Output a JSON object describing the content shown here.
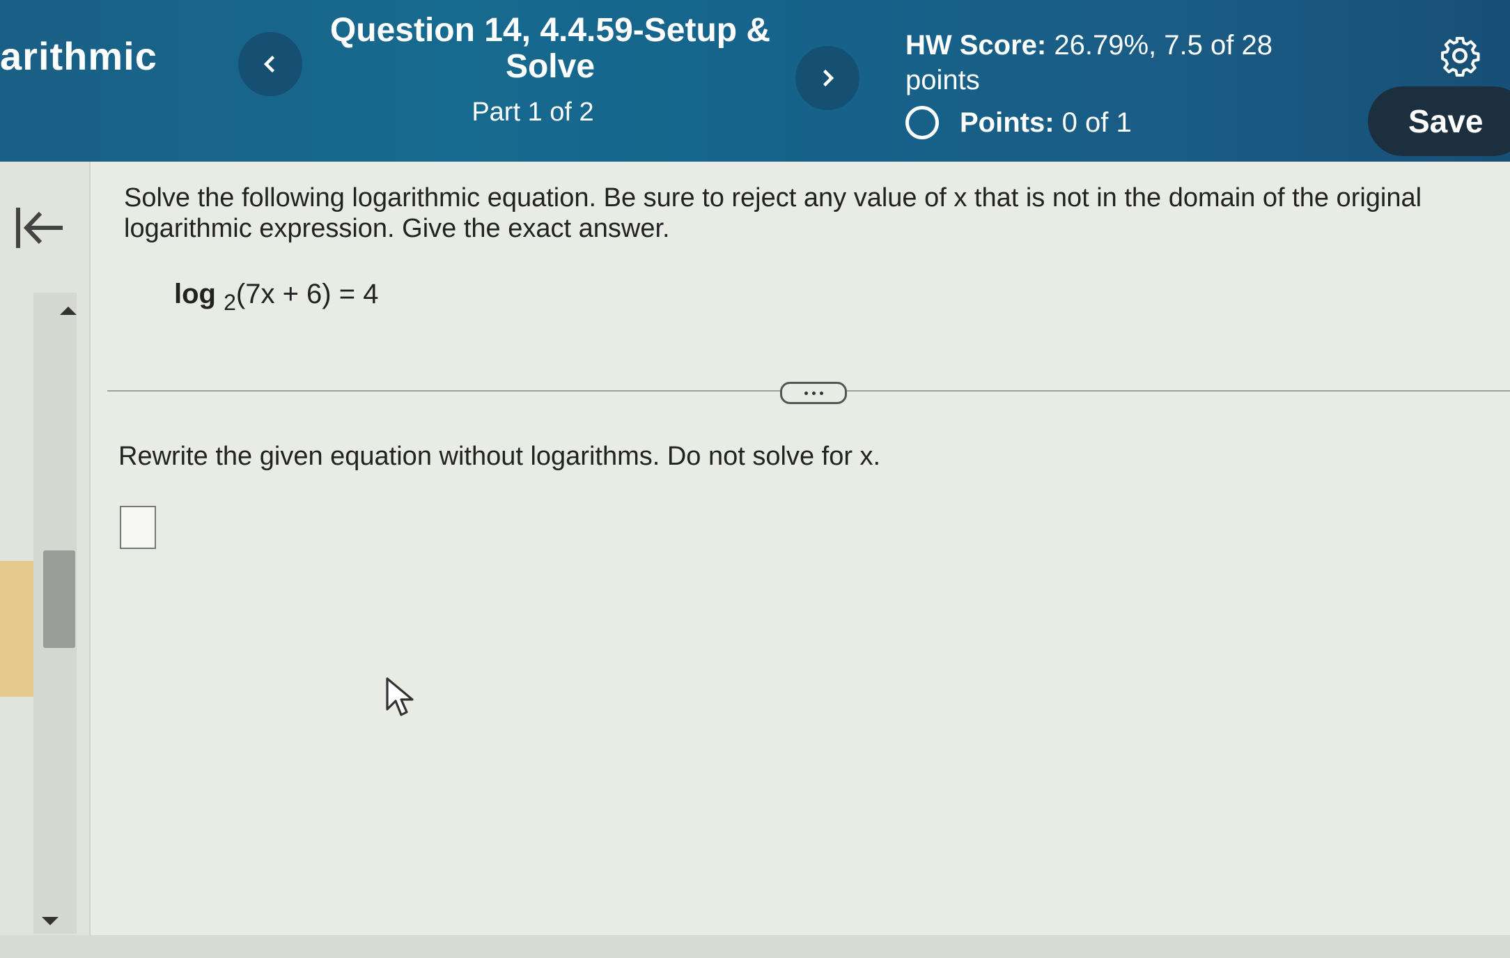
{
  "header": {
    "course_title": "arithmic",
    "question_title": "Question 14, 4.4.59-Setup & Solve",
    "part": "Part 1 of 2",
    "hw_score_label": "HW Score:",
    "hw_score_value": "26.79%, 7.5 of 28 points",
    "points_label": "Points:",
    "points_value": "0 of 1",
    "save_label": "Save",
    "prev_icon": "chevron-left-icon",
    "next_icon": "chevron-right-icon",
    "settings_icon": "gear-icon"
  },
  "question": {
    "instructions": "Solve the following logarithmic equation. Be sure to reject any value of x that is not in the domain of the original logarithmic expression. Give the exact answer.",
    "equation": {
      "func": "log",
      "base": "2",
      "expr": "(7x + 6) = 4"
    },
    "prompt": "Rewrite the given equation without logarithms. Do not solve for x.",
    "answer_value": ""
  },
  "colors": {
    "header_bg": "#176a8f",
    "save_bg": "#1b2f3e",
    "content_bg": "#e9ece4"
  }
}
